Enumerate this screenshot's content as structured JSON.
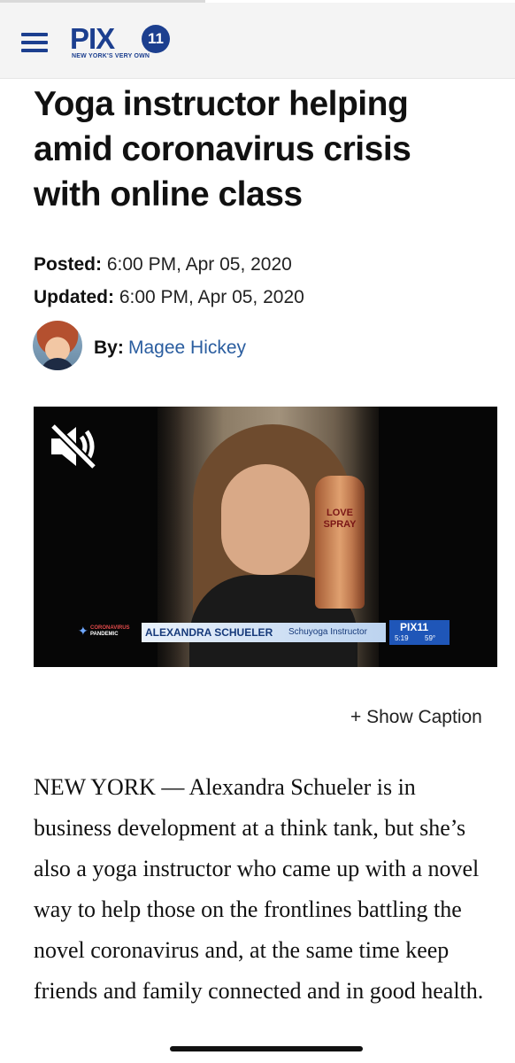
{
  "header": {
    "logo_word": "PIX",
    "logo_number": "11",
    "logo_tagline": "NEW YORK'S VERY OWN"
  },
  "article": {
    "headline": "Yoga instructor helping amid coronavirus crisis with online class",
    "posted_label": "Posted:",
    "posted_value": "6:00 PM, Apr 05, 2020",
    "updated_label": "Updated:",
    "updated_value": "6:00 PM, Apr 05, 2020",
    "by_label": "By:",
    "author": "Magee Hickey",
    "body": "NEW YORK — Alexandra Schueler is in business development at a think tank, but she’s also a yoga instructor who came up with a novel way to help those on the frontlines battling the novel coronavirus and, at the same time keep friends and family connected and in good health."
  },
  "video": {
    "can_text": "LOVE SPRAY",
    "tag_top": "CORONAVIRUS",
    "tag_bottom": "PANDEMIC",
    "lower_third_name": "ALEXANDRA SCHUELER",
    "lower_third_role": "Schuyoga Instructor",
    "station": "PIX11",
    "time": "5:19",
    "temperature": "59°",
    "muted": true
  },
  "caption_toggle": "+ Show Caption",
  "colors": {
    "brand_blue": "#1c3f8f",
    "author_link": "#2a5d9f",
    "header_bg": "#f4f4f4"
  }
}
